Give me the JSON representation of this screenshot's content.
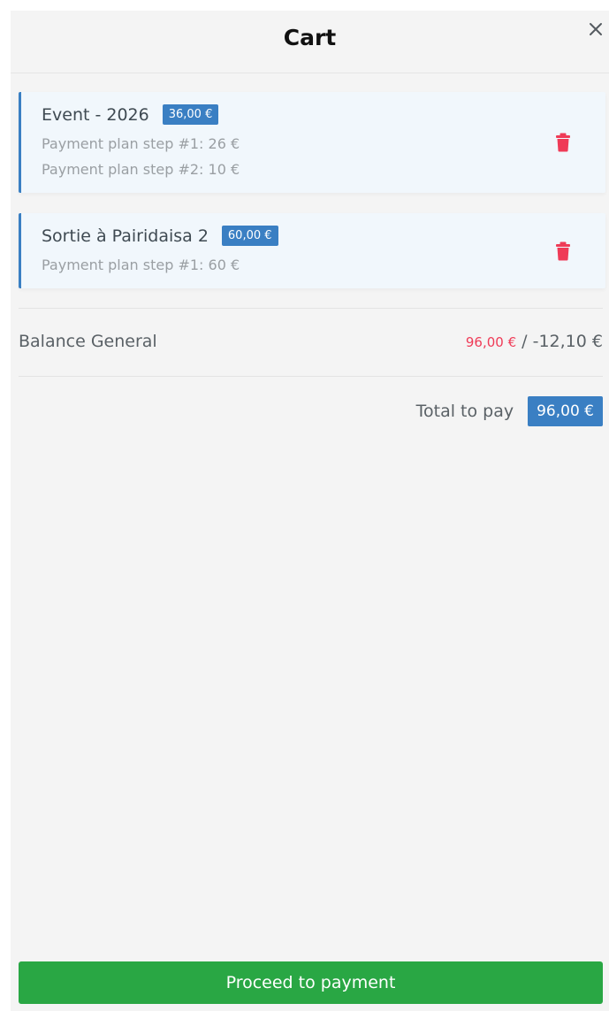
{
  "header": {
    "title": "Cart",
    "close_icon": "close-icon"
  },
  "items": [
    {
      "title": "Event - 2026",
      "price": "36,00 €",
      "steps": [
        "Payment plan step #1: 26 €",
        "Payment plan step #2: 10 €"
      ],
      "delete_icon": "trash-icon"
    },
    {
      "title": "Sortie à  Pairidaisa 2",
      "price": "60,00 €",
      "steps": [
        "Payment plan step #1: 60 €"
      ],
      "delete_icon": "trash-icon"
    }
  ],
  "balance": {
    "label": "Balance General",
    "due": "96,00 €",
    "separator": " / ",
    "account": "-12,10 €"
  },
  "total": {
    "label": "Total to pay",
    "value": "96,00 €"
  },
  "actions": {
    "pay_label": "Proceed to payment"
  },
  "colors": {
    "accent_blue": "#3a7fc3",
    "danger_red": "#ef3b57",
    "success_green": "#29a744",
    "panel_bg": "#f4f4f4",
    "item_bg": "#f1f7fc"
  }
}
